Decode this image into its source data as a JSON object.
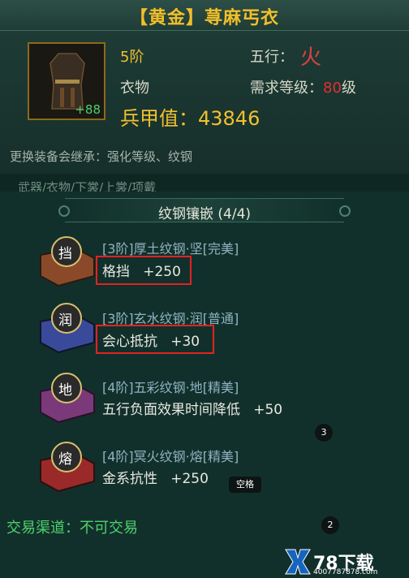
{
  "window": {
    "title": "【黄金】荨麻丐衣"
  },
  "item": {
    "plus_level": "+88",
    "tier": "5阶",
    "element_label": "五行：",
    "element_value": "火",
    "category": "衣物",
    "level_req_label": "需求等级：",
    "level_req_value": "80",
    "level_req_unit": "级",
    "armor_label": "兵甲值：",
    "armor_value": "43846"
  },
  "inherit_note": "更换装备会继承：强化等级、纹钢",
  "partial_tabs_text": "武器/衣物/下裳/上裳/项戴",
  "gems_section": {
    "title": "纹钢镶嵌 (4/4)",
    "gems": [
      {
        "char": "挡",
        "name": "[3阶]厚土纹钢·坚[完美]",
        "stat_name": "格挡",
        "stat_value": "+250",
        "color": "#8a4a2a"
      },
      {
        "char": "润",
        "name": "[3阶]玄水纹钢·润[普通]",
        "stat_name": "会心抵抗",
        "stat_value": "+30",
        "color": "#3a4a9a"
      },
      {
        "char": "地",
        "name": "[4阶]五彩纹钢·地[精美]",
        "stat_name": "五行负面效果时间降低",
        "stat_value": "+50",
        "color": "#7a3a7a"
      },
      {
        "char": "熔",
        "name": "[4阶]冥火纹钢·熔[精美]",
        "stat_name": "金系抗性",
        "stat_value": "+250",
        "color": "#9a2a2a"
      }
    ]
  },
  "badges": {
    "b1": "3",
    "b2": "2"
  },
  "tooltip": "空格",
  "trade": "交易渠道：不可交易",
  "watermark": {
    "text": "78下载",
    "url": "4007787878.com"
  },
  "colors": {
    "gold": "#f0c030",
    "green": "#4fd06a",
    "highlight_box": "#e32222"
  }
}
